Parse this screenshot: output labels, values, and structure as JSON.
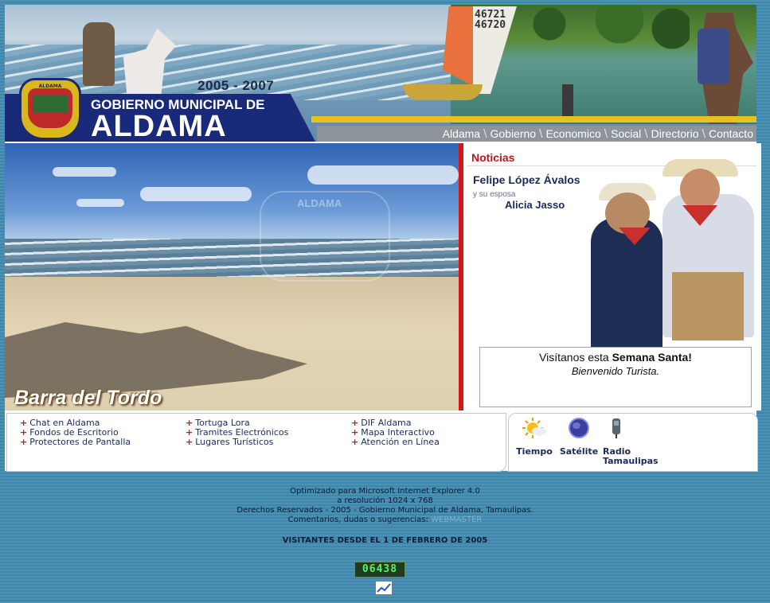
{
  "header": {
    "years": "2005 - 2007",
    "government": "GOBIERNO MUNICIPAL DE",
    "municipality": "ALDAMA",
    "sail_number_top": "46721",
    "sail_number_bottom": "46720",
    "shield_text": "ALDAMA"
  },
  "nav": [
    "Aldama",
    "Gobierno",
    "Economico",
    "Social",
    "Directorio",
    "Contacto"
  ],
  "hero": {
    "caption": "Barra del Tordo",
    "watermark": "ALDAMA"
  },
  "news": {
    "title": "Noticias",
    "name": "Felipe López Ávalos",
    "spouse_intro": "y su esposa",
    "spouse": "Alicia Jasso",
    "visit_prefix": "Visítanos esta ",
    "visit_bold": "Semana Santa!",
    "welcome": "Bienvenido Turista."
  },
  "links": {
    "col1": [
      "Chat en Aldama",
      "Fondos de Escritorio",
      "Protectores de Pantalla"
    ],
    "col2": [
      "Tortuga Lora",
      "Tramites Electrónicos",
      "Lugares Turísticos"
    ],
    "col3": [
      "DIF Aldama",
      "Mapa Interactivo",
      "Atención en Línea"
    ]
  },
  "quick_icons": [
    {
      "label": "Tiempo",
      "icon": "weather-icon"
    },
    {
      "label": "Satélite",
      "icon": "satellite-icon"
    },
    {
      "label": "Radio Tamaulipas",
      "icon": "radio-icon"
    }
  ],
  "footer": {
    "line1": "Optimizado para Microsoft Internet Explorer 4.0",
    "line2": "a resolución 1024 x 768",
    "line3": "Derechos Reservados - 2005 - Gobierno Municipal de Aldama, Tamaulipas.",
    "line4_prefix": "Comentarios, dudas o sugerencias:",
    "webmaster": "WEBMASTER",
    "visitors": "VISITANTES DESDE EL 1 DE FEBRERO DE 2005",
    "counter": "06438"
  },
  "colors": {
    "brand_navy": "#1a2a7a",
    "accent_red": "#d7141a",
    "accent_gold": "#e8c21c",
    "page_bg": "#4b92b5"
  }
}
